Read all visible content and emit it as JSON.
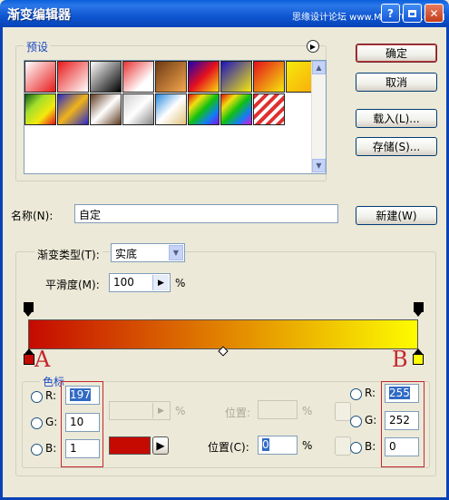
{
  "window": {
    "title": "渐变编辑器",
    "watermark": "思缘设计论坛 www.MISSYUAN.COM"
  },
  "presets": {
    "legend": "预设",
    "swatches": [
      "linear-gradient(135deg, #fff, #E81A1A)",
      "linear-gradient(135deg, #E81A1A, #fff)",
      "linear-gradient(135deg, #fff, #000)",
      "linear-gradient(135deg, #E83232, #fff 70%)",
      "linear-gradient(135deg, #6E3A13, #F5A74E)",
      "linear-gradient(135deg, #1F00B4, #E5101D, #F9DB10)",
      "linear-gradient(135deg, #1B12C0, #F5E90C)",
      "linear-gradient(135deg, #E5101D, #F5E90C)",
      "linear-gradient(135deg, #F5E90C, #FAAA0A)",
      "linear-gradient(135deg, #0F5E17, #A2DE2D, #F5E90C, #E5101D)",
      "linear-gradient(135deg, #2A2AC8, #F0B419, #2A2AC8)",
      "linear-gradient(135deg, #5E3A1F, #FFFFFF, #5E3A1F)",
      "linear-gradient(135deg, #D0D0D0, #fff, #888)",
      "linear-gradient(135deg, #2A8AE0, #fff, #E0C27A)",
      "linear-gradient(135deg, #E01010, #F0E010, #10C010, #1080F0, #8010F0)",
      "linear-gradient(135deg, #E01010, #F0E010, #10C010, #1080F0, #E010E0)",
      "repeating-linear-gradient(135deg, #E03030 0 4px, #fff 4px 8px)"
    ]
  },
  "buttons": {
    "ok": "确定",
    "cancel": "取消",
    "load": "载入(L)...",
    "save": "存储(S)...",
    "new": "新建(W)"
  },
  "name_field": {
    "label": "名称(N):",
    "value": "自定"
  },
  "gradient": {
    "type_label": "渐变类型(T):",
    "type_value": "实底",
    "smooth_label": "平滑度(M):",
    "smooth_value": "100",
    "percent": "%",
    "start_color": "#C50A01",
    "end_color": "#FDFC00"
  },
  "stops": {
    "legend": "色标",
    "opacity_percent": "%",
    "position_top_label": "位置:",
    "position_label": "位置(C):",
    "position_value": "0",
    "position_percent": "%"
  },
  "color_a": {
    "annotation": "A",
    "r_label": "R:",
    "r": "197",
    "g_label": "G:",
    "g": "10",
    "b_label": "B:",
    "b": "1",
    "swatch": "#C50A01"
  },
  "color_b": {
    "annotation": "B",
    "r_label": "R:",
    "r": "255",
    "g_label": "G:",
    "g": "252",
    "b_label": "B:",
    "b": "0"
  }
}
